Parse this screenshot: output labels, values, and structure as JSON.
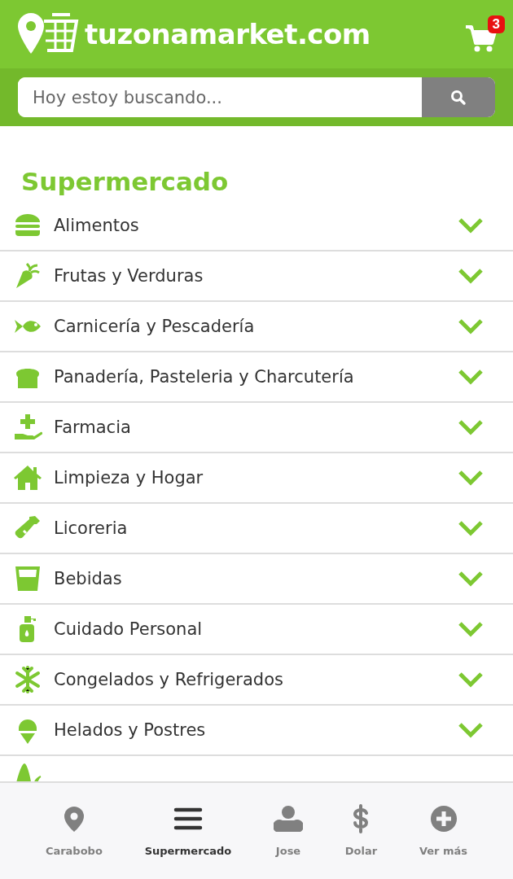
{
  "header": {
    "logo_text": "tuzonamarket.com",
    "cart_count": "3"
  },
  "search": {
    "placeholder": "Hoy estoy buscando..."
  },
  "section_title": "Supermercado",
  "categories": [
    {
      "label": "Alimentos"
    },
    {
      "label": "Frutas y Verduras"
    },
    {
      "label": "Carnicería y Pescadería"
    },
    {
      "label": "Panadería, Pasteleria y Charcutería"
    },
    {
      "label": "Farmacia"
    },
    {
      "label": "Limpieza y Hogar"
    },
    {
      "label": "Licoreria"
    },
    {
      "label": "Bebidas"
    },
    {
      "label": "Cuidado Personal"
    },
    {
      "label": "Congelados y Refrigerados"
    },
    {
      "label": "Helados y Postres"
    }
  ],
  "bottom_nav": [
    {
      "label": "Carabobo",
      "selected": false
    },
    {
      "label": "Supermercado",
      "selected": true
    },
    {
      "label": "Jose",
      "selected": false
    },
    {
      "label": "Dolar",
      "selected": false
    },
    {
      "label": "Ver más",
      "selected": false
    }
  ]
}
